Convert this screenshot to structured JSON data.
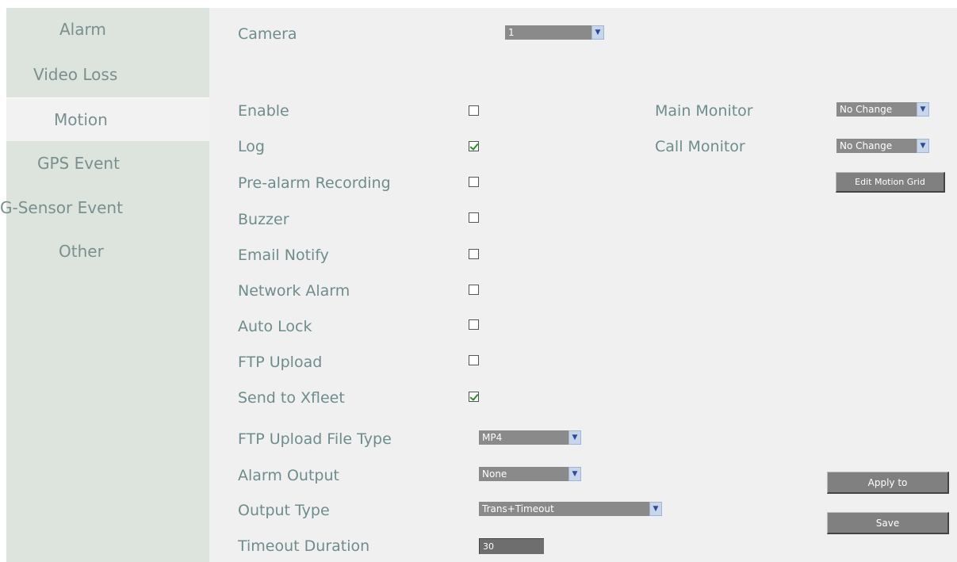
{
  "sidebar": {
    "items": [
      {
        "label": "Alarm"
      },
      {
        "label": "Video Loss"
      },
      {
        "label": "Motion"
      },
      {
        "label": "GPS Event"
      },
      {
        "label": "G-Sensor Event"
      },
      {
        "label": "Other"
      }
    ],
    "active": "Motion"
  },
  "form": {
    "camera": {
      "label": "Camera",
      "value": "1"
    },
    "options": [
      {
        "label": "Enable",
        "checked": false
      },
      {
        "label": "Log",
        "checked": true
      },
      {
        "label": "Pre-alarm Recording",
        "checked": false
      },
      {
        "label": "Buzzer",
        "checked": false
      },
      {
        "label": "Email Notify",
        "checked": false
      },
      {
        "label": "Network Alarm",
        "checked": false
      },
      {
        "label": "Auto Lock",
        "checked": false
      },
      {
        "label": "FTP Upload",
        "checked": false
      },
      {
        "label": "Send to Xfleet",
        "checked": true
      }
    ],
    "main_monitor": {
      "label": "Main Monitor",
      "value": "No Change"
    },
    "call_monitor": {
      "label": "Call Monitor",
      "value": "No Change"
    },
    "edit_motion_grid_label": "Edit Motion Grid",
    "ftp_file_type": {
      "label": "FTP Upload File Type",
      "value": "MP4"
    },
    "alarm_output": {
      "label": "Alarm Output",
      "value": "None"
    },
    "output_type": {
      "label": "Output Type",
      "value": "Trans+Timeout"
    },
    "timeout_duration": {
      "label": "Timeout Duration",
      "value": "30"
    },
    "apply_to_label": "Apply to",
    "save_label": "Save"
  },
  "colors": {
    "sidebar_bg": "#dde4dd",
    "main_bg": "#f0f0f0",
    "label_text": "#6f8c8c",
    "select_bg": "#8a8a8a",
    "button_bg": "#808080",
    "check_green": "#2e8a2e"
  },
  "icons": {
    "dropdown": "chevron-down-icon",
    "checkbox": "checkbox-icon"
  }
}
